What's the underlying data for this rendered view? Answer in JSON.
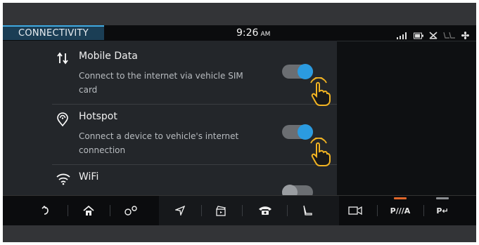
{
  "header": {
    "section_title": "CONNECTIVITY",
    "time": "9:26",
    "ampm": "AM"
  },
  "status_icons": [
    "signal-bars-icon",
    "battery-icon",
    "phone-muted-icon",
    "seat-icon",
    "fan-icon"
  ],
  "settings": [
    {
      "icon": "mobile-data-arrows-icon",
      "title": "Mobile Data",
      "description": "Connect to the internet via vehicle SIM card",
      "toggle": "on"
    },
    {
      "icon": "hotspot-icon",
      "title": "Hotspot",
      "description": "Connect a device to vehicle's internet connection",
      "toggle": "on"
    },
    {
      "icon": "wifi-icon",
      "title": "WiFi",
      "description": "",
      "toggle": "off"
    }
  ],
  "dock": {
    "items": [
      "back-icon",
      "home-icon",
      "settings-gears-icon",
      "navigation-arrow-icon",
      "media-clapper-icon",
      "phone-icon",
      "seat-icon",
      "camera-icon",
      "parking-assist-icon",
      "park-exit-icon"
    ],
    "labels": {
      "parking": "P///A",
      "park_exit": "P↵"
    },
    "indicator_colors": {
      "parking": "#e0662a",
      "park_exit": "#8a8d91"
    }
  },
  "colors": {
    "accent": "#2b9be0",
    "title_tab": "#1b3e55",
    "hand_highlight": "#f1b323"
  }
}
